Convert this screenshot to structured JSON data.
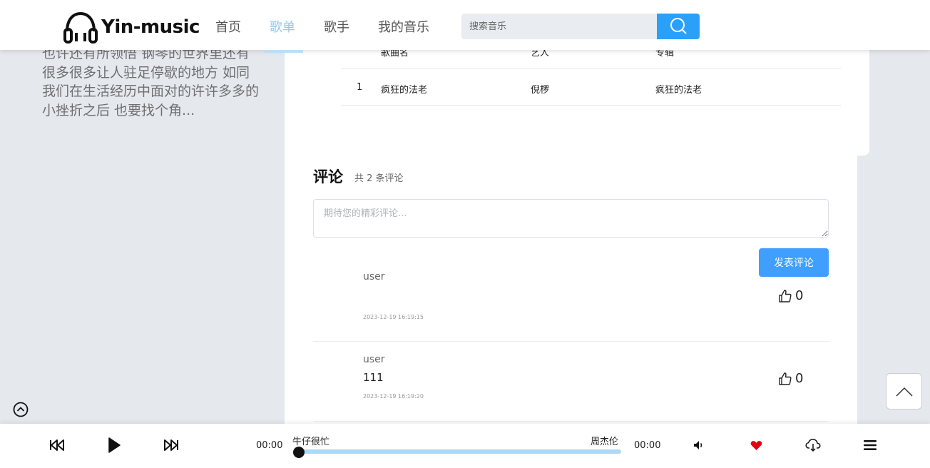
{
  "header": {
    "app_name": "Yin-music",
    "nav": [
      "首页",
      "歌单",
      "歌手",
      "我的音乐"
    ],
    "active_nav": "歌单",
    "search_placeholder": "搜索音乐"
  },
  "intro": {
    "text": "也许还有所领悟 钢琴的世界里还有很多很多让人驻足停歇的地方 如同我们在生活经历中面对的许许多多的小挫折之后 也要找个角..."
  },
  "song_table": {
    "headers": [
      "歌曲名",
      "艺人",
      "专辑"
    ],
    "rows": [
      {
        "index": "1",
        "name": "疯狂的法老",
        "artist": "倪椤",
        "album": "疯狂的法老"
      }
    ]
  },
  "comments": {
    "title": "评论",
    "count_text": "共 2 条评论",
    "input_placeholder": "期待您的精彩评论...",
    "submit_label": "发表评论",
    "items": [
      {
        "user": "user",
        "text": "",
        "time": "2023-12-19 16:19:15",
        "likes": "0"
      },
      {
        "user": "user",
        "text": "111",
        "time": "2023-12-19 16:19:20",
        "likes": "0"
      }
    ]
  },
  "player": {
    "current_time": "00:00",
    "total_time": "00:00",
    "song_title": "牛仔很忙",
    "song_artist": "周杰伦",
    "progress": 0
  },
  "colors": {
    "accent": "#2ba0f8",
    "button": "#409eff",
    "nav_active": "#95c8ea",
    "heart": "#e60012"
  },
  "icons": [
    "headphones-logo-icon",
    "search-icon",
    "thumbs-up-icon",
    "chevron-up-icon",
    "collapse-icon",
    "rewind-icon",
    "play-icon",
    "fast-forward-icon",
    "volume-icon",
    "heart-icon",
    "download-icon",
    "menu-icon"
  ]
}
